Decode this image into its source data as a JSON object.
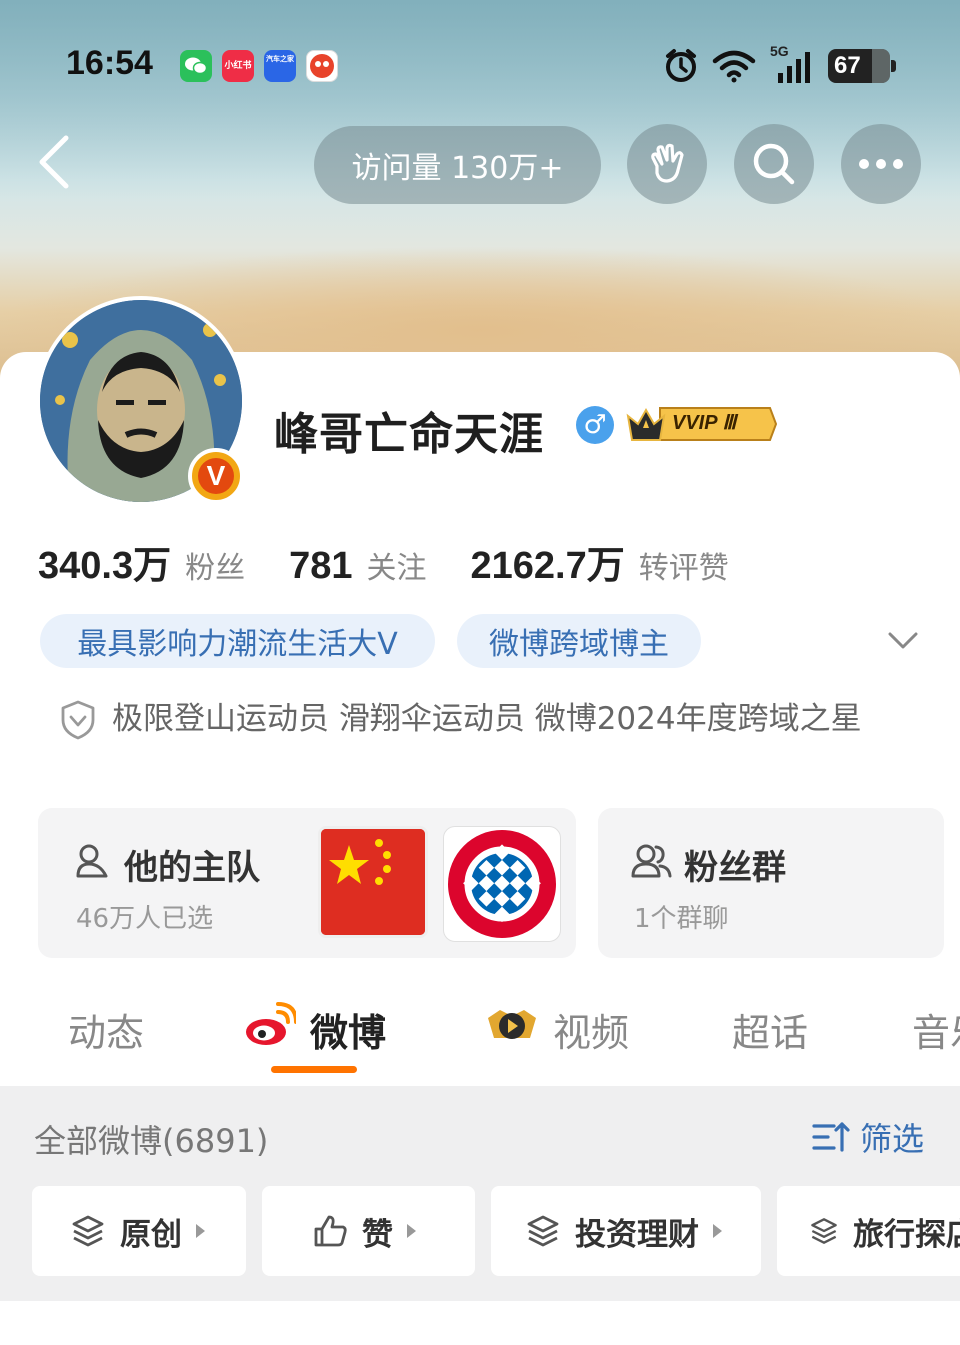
{
  "status_bar": {
    "time": "16:54",
    "apps": [
      {
        "name": "wechat",
        "color": "#2bc05b",
        "label": ""
      },
      {
        "name": "xiaohongshu",
        "color": "#ef2d46",
        "label": "小红书"
      },
      {
        "name": "autohome",
        "color": "#2a66e6",
        "label": "汽车之家"
      },
      {
        "name": "taobao-special",
        "color": "#e8432b",
        "label": ""
      }
    ],
    "network": "5G",
    "battery": "67"
  },
  "header": {
    "visits_label": "访问量 130万+"
  },
  "profile": {
    "name": "峰哥亡命天涯",
    "gender_symbol": "♂",
    "vip_label": "VVIP Ⅲ",
    "verified_mark": "V",
    "stats": [
      {
        "num": "340.3万",
        "label": "粉丝"
      },
      {
        "num": "781",
        "label": "关注"
      },
      {
        "num": "2162.7万",
        "label": "转评赞"
      }
    ],
    "tags": [
      "最具影响力潮流生活大V",
      "微博跨域博主"
    ],
    "bio": "极限登山运动员 滑翔伞运动员 微博2024年度跨域之星"
  },
  "team_box": {
    "title": "他的主队",
    "sub": "46万人已选",
    "badge_text": "FC BAYERN MÜNCHEN"
  },
  "fans_box": {
    "title": "粉丝群",
    "sub": "1个群聊"
  },
  "tabs": [
    "动态",
    "微博",
    "视频",
    "超话",
    "音乐"
  ],
  "active_tab": "微博",
  "feed": {
    "all_label": "全部微博(6891)",
    "filter_label": "筛选",
    "chips": [
      "原创",
      "赞",
      "投资理财",
      "旅行探店"
    ]
  },
  "colors": {
    "accent": "#ff7300",
    "link_blue": "#386fb3",
    "tag_bg": "#e9f1fb"
  }
}
